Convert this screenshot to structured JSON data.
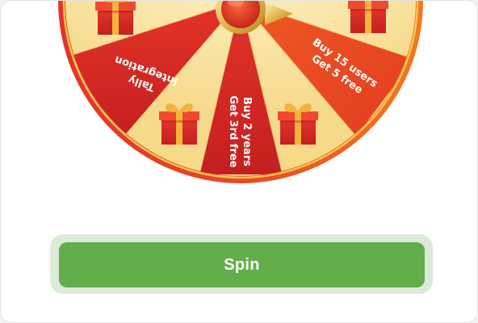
{
  "wheel": {
    "segments": [
      {
        "line1": "Tally",
        "line2": "integration"
      },
      {
        "line1": "Buy 2 years",
        "line2": "Get 3rd free"
      },
      {
        "line1": "Buy 15 users",
        "line2": "Get 5 free"
      }
    ],
    "prize_icon": "gift-box-icon",
    "pointer_icon": "wheel-pointer-icon"
  },
  "spin_button": {
    "label": "Spin"
  },
  "colors": {
    "wheel_rim": "#e53a2a",
    "red_segment": "#d92a22",
    "cream_segment": "#fbe9b0",
    "gold": "#e3b54a",
    "button": "#63ad4a",
    "button_halo": "#dcebd7"
  }
}
